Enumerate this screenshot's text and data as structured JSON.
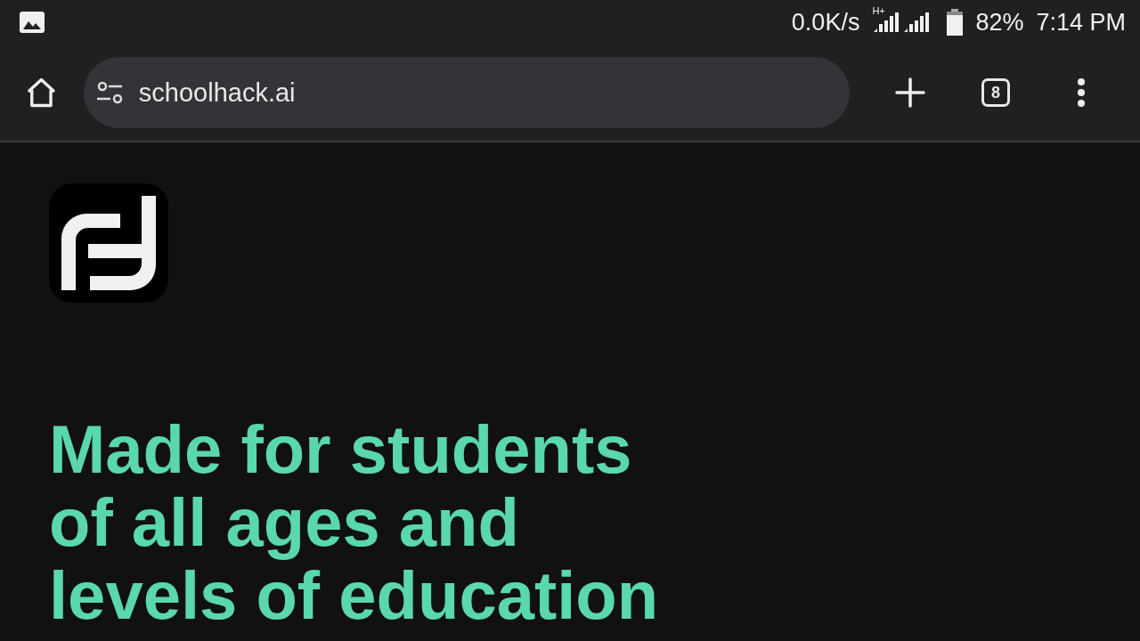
{
  "status_bar": {
    "speed": "0.0K/s",
    "network": "H+",
    "battery": "82%",
    "time": "7:14 PM"
  },
  "browser": {
    "url": "schoolhack.ai",
    "tab_count": "8"
  },
  "page": {
    "headline": "Made for students\nof all ages and\nlevels of education"
  }
}
